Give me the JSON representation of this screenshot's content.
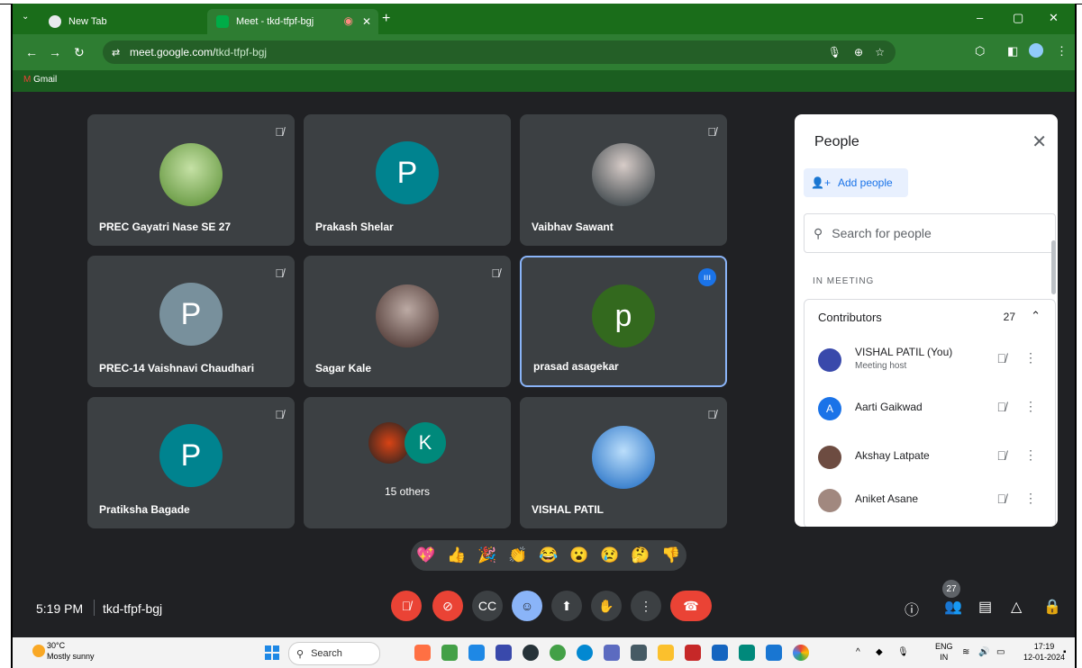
{
  "browser": {
    "tabs": [
      {
        "label": "New Tab",
        "active": false
      },
      {
        "label": "Meet - tkd-tfpf-bgj",
        "active": true
      }
    ],
    "url_host": "meet.google.com/",
    "url_path": "tkd-tfpf-bgj",
    "bookmark": "Gmail",
    "window_controls": [
      "–",
      "▢",
      "✕"
    ]
  },
  "tiles": [
    {
      "name": "PREC Gayatri Nase SE 27",
      "muted": true,
      "type": "photo",
      "color": "#7cb342"
    },
    {
      "name": "Prakash Shelar",
      "muted": false,
      "type": "letter",
      "letter": "P",
      "color": "#00838f"
    },
    {
      "name": "Vaibhav Sawant",
      "muted": true,
      "type": "photo",
      "color": "#5d4037"
    },
    {
      "name": "PREC-14 Vaishnavi Chaudhari",
      "muted": true,
      "type": "letter",
      "letter": "P",
      "color": "#78909c"
    },
    {
      "name": "Sagar Kale",
      "muted": true,
      "type": "photo",
      "color": "#6d4c41"
    },
    {
      "name": "prasad asagekar",
      "muted": false,
      "type": "letter",
      "letter": "p",
      "color": "#33691e",
      "speaking": true
    },
    {
      "name": "Pratiksha Bagade",
      "muted": true,
      "type": "letter",
      "letter": "P",
      "color": "#00838f"
    },
    {
      "name": "15 others",
      "muted": false,
      "type": "others",
      "letter": "K",
      "color": "#00897b"
    },
    {
      "name": "VISHAL PATIL",
      "muted": true,
      "type": "photo",
      "color": "#1e88e5"
    }
  ],
  "people": {
    "title": "People",
    "add_label": "Add people",
    "search_placeholder": "Search for people",
    "section": "IN MEETING",
    "group_label": "Contributors",
    "group_count": "27",
    "members": [
      {
        "name": "VISHAL PATIL (You)",
        "sub": "Meeting host",
        "type": "photo",
        "color": "#3949ab"
      },
      {
        "name": "Aarti Gaikwad",
        "sub": "",
        "type": "letter",
        "letter": "A",
        "color": "#1a73e8"
      },
      {
        "name": "Akshay Latpate",
        "sub": "",
        "type": "photo",
        "color": "#6d4c41"
      },
      {
        "name": "Aniket Asane",
        "sub": "",
        "type": "photo",
        "color": "#a1887f"
      }
    ]
  },
  "reactions": [
    "💖",
    "👍",
    "🎉",
    "👏",
    "😂",
    "😮",
    "😢",
    "🤔",
    "👎"
  ],
  "bottom": {
    "time": "5:19 PM",
    "meeting_code": "tkd-tfpf-bgj",
    "participant_badge": "27"
  },
  "taskbar": {
    "temp": "30°C",
    "weather": "Mostly sunny",
    "search_label": "Search",
    "lang_top": "ENG",
    "lang_bottom": "IN",
    "time": "17:19",
    "date": "12-01-2024"
  }
}
